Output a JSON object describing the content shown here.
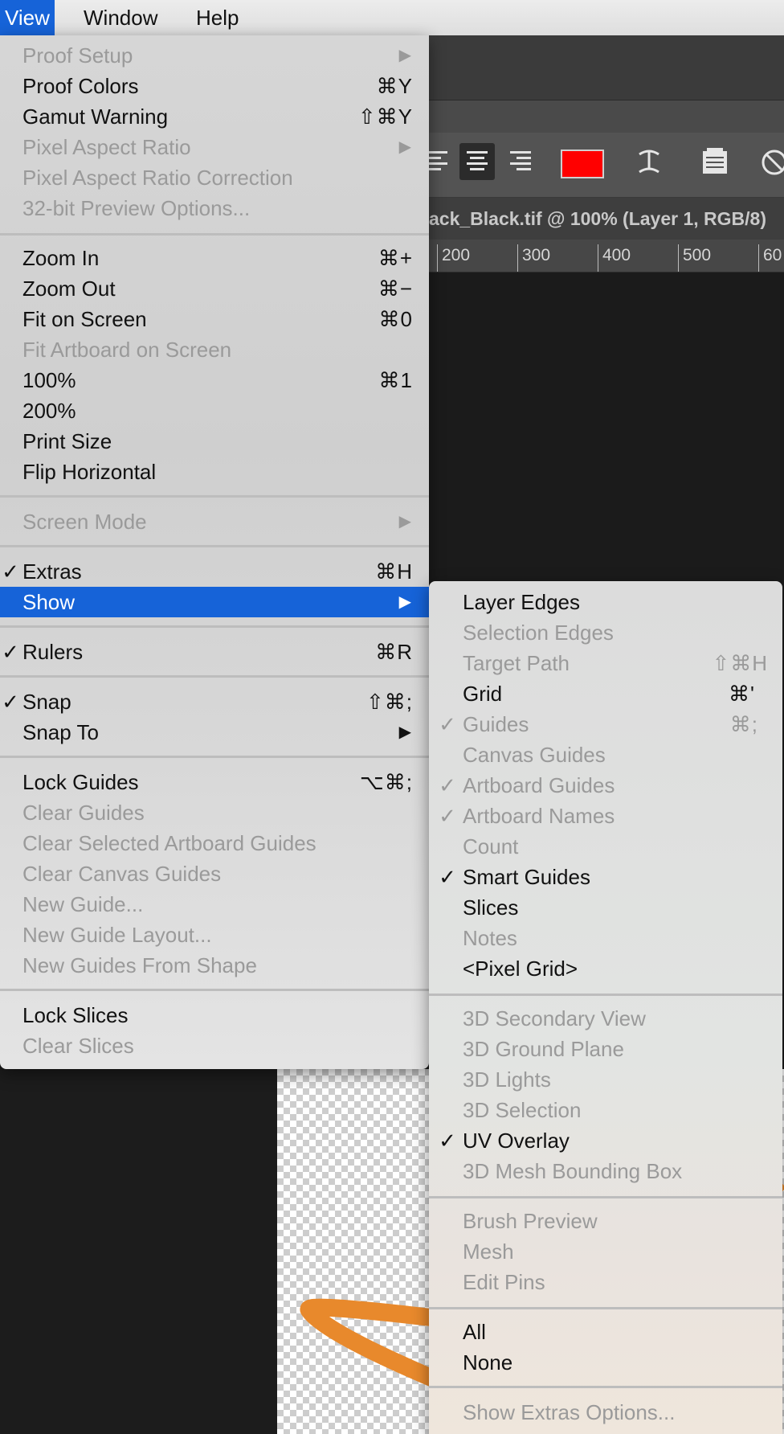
{
  "menubar": {
    "view": "View",
    "window": "Window",
    "help": "Help"
  },
  "document": {
    "tab_title": "ack_Black.tif @ 100% (Layer 1, RGB/8)"
  },
  "ruler": {
    "labels": [
      "200",
      "300",
      "400",
      "500",
      "60"
    ]
  },
  "colors": {
    "highlight": "#1663d8",
    "swatch": "#ff0000",
    "stroke": "#e8892c"
  },
  "view_menu": {
    "proof_setup": "Proof Setup",
    "proof_colors": {
      "label": "Proof Colors",
      "shortcut": "⌘Y"
    },
    "gamut_warning": {
      "label": "Gamut Warning",
      "shortcut": "⇧⌘Y"
    },
    "pixel_aspect_ratio": "Pixel Aspect Ratio",
    "pixel_aspect_ratio_correction": "Pixel Aspect Ratio Correction",
    "preview_32bit": "32-bit Preview Options...",
    "zoom_in": {
      "label": "Zoom In",
      "shortcut": "⌘+"
    },
    "zoom_out": {
      "label": "Zoom Out",
      "shortcut": "⌘−"
    },
    "fit_on_screen": {
      "label": "Fit on Screen",
      "shortcut": "⌘0"
    },
    "fit_artboard": "Fit Artboard on Screen",
    "zoom_100": {
      "label": "100%",
      "shortcut": "⌘1"
    },
    "zoom_200": "200%",
    "print_size": "Print Size",
    "flip_horizontal": "Flip Horizontal",
    "screen_mode": "Screen Mode",
    "extras": {
      "label": "Extras",
      "shortcut": "⌘H",
      "checked": "✓"
    },
    "show": "Show",
    "rulers": {
      "label": "Rulers",
      "shortcut": "⌘R",
      "checked": "✓"
    },
    "snap": {
      "label": "Snap",
      "shortcut": "⇧⌘;",
      "checked": "✓"
    },
    "snap_to": "Snap To",
    "lock_guides": {
      "label": "Lock Guides",
      "shortcut": "⌥⌘;"
    },
    "clear_guides": "Clear Guides",
    "clear_selected_artboard_guides": "Clear Selected Artboard Guides",
    "clear_canvas_guides": "Clear Canvas Guides",
    "new_guide": "New Guide...",
    "new_guide_layout": "New Guide Layout...",
    "new_guides_from_shape": "New Guides From Shape",
    "lock_slices": "Lock Slices",
    "clear_slices": "Clear Slices",
    "submenu_arrow": "▶"
  },
  "show_menu": {
    "layer_edges": "Layer Edges",
    "selection_edges": "Selection Edges",
    "target_path": {
      "label": "Target Path",
      "shortcut": "⇧⌘H"
    },
    "grid": {
      "label": "Grid",
      "shortcut": "⌘'"
    },
    "guides": {
      "label": "Guides",
      "shortcut": "⌘;",
      "checked": "✓"
    },
    "canvas_guides": "Canvas Guides",
    "artboard_guides": {
      "label": "Artboard Guides",
      "checked": "✓"
    },
    "artboard_names": {
      "label": "Artboard Names",
      "checked": "✓"
    },
    "count": "Count",
    "smart_guides": {
      "label": "Smart Guides",
      "checked": "✓"
    },
    "slices": "Slices",
    "notes": "Notes",
    "pixel_grid": "<Pixel Grid>",
    "secondary_view_3d": "3D Secondary View",
    "ground_plane_3d": "3D Ground Plane",
    "lights_3d": "3D Lights",
    "selection_3d": "3D Selection",
    "uv_overlay": {
      "label": "UV Overlay",
      "checked": "✓"
    },
    "mesh_bounding_box_3d": "3D Mesh Bounding Box",
    "brush_preview": "Brush Preview",
    "mesh": "Mesh",
    "edit_pins": "Edit Pins",
    "all": "All",
    "none": "None",
    "show_extras_options": "Show Extras Options..."
  }
}
